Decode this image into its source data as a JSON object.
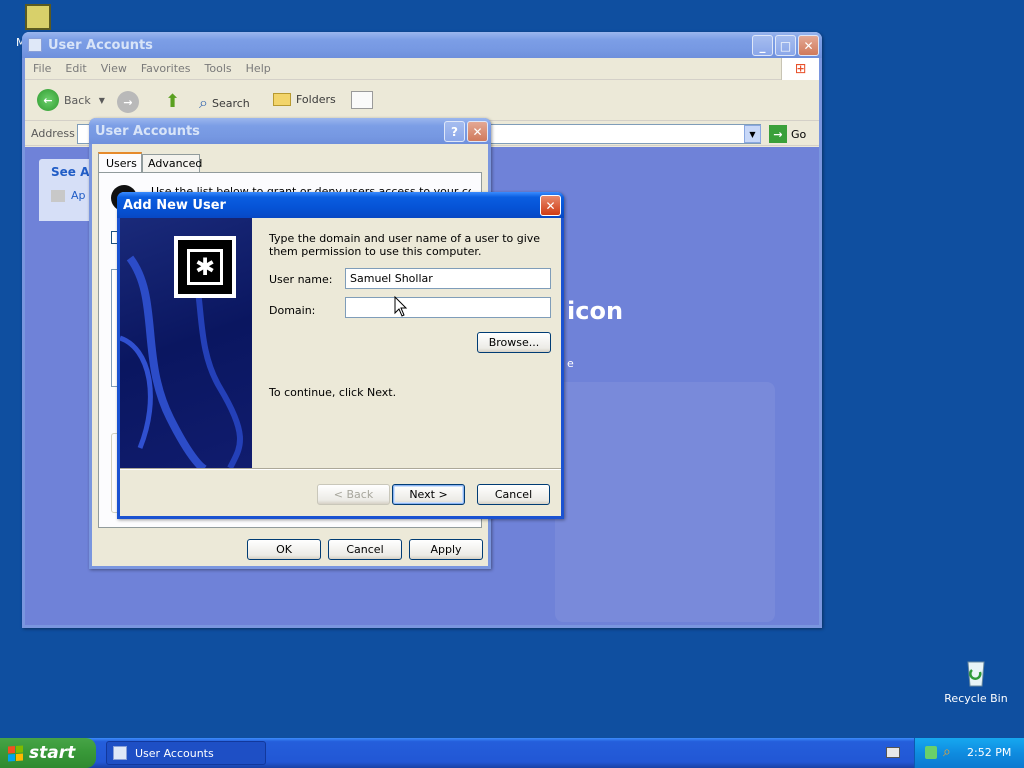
{
  "desktop": {
    "icons": [
      {
        "label": "M"
      },
      {
        "label": "Recycle Bin"
      }
    ]
  },
  "main_window": {
    "title": "User Accounts",
    "menu": [
      "File",
      "Edit",
      "View",
      "Favorites",
      "Tools",
      "Help"
    ],
    "toolbar": {
      "back": "Back",
      "search": "Search",
      "folders": "Folders"
    },
    "address_label": "Address",
    "go_label": "Go",
    "see_also": "See Al",
    "see_also_item": "Ap",
    "banner_text": "icon",
    "banner_sub": "e"
  },
  "ua_dialog": {
    "title": "User Accounts",
    "tabs": [
      "Users",
      "Advanced"
    ],
    "intro": "Use the list below to grant or deny users access to your computer",
    "ok": "OK",
    "cancel": "Cancel",
    "apply": "Apply"
  },
  "add_user": {
    "title": "Add New User",
    "instructions": "Type the domain and user name of a user to give them permission to use this computer.",
    "user_name_label": "User name:",
    "user_name_value": "Samuel Shollar",
    "domain_label": "Domain:",
    "domain_value": "",
    "browse": "Browse...",
    "continue_text": "To continue, click Next.",
    "back": "< Back",
    "next": "Next >",
    "cancel": "Cancel"
  },
  "taskbar": {
    "start": "start",
    "task": "User Accounts",
    "clock": "2:52 PM"
  }
}
